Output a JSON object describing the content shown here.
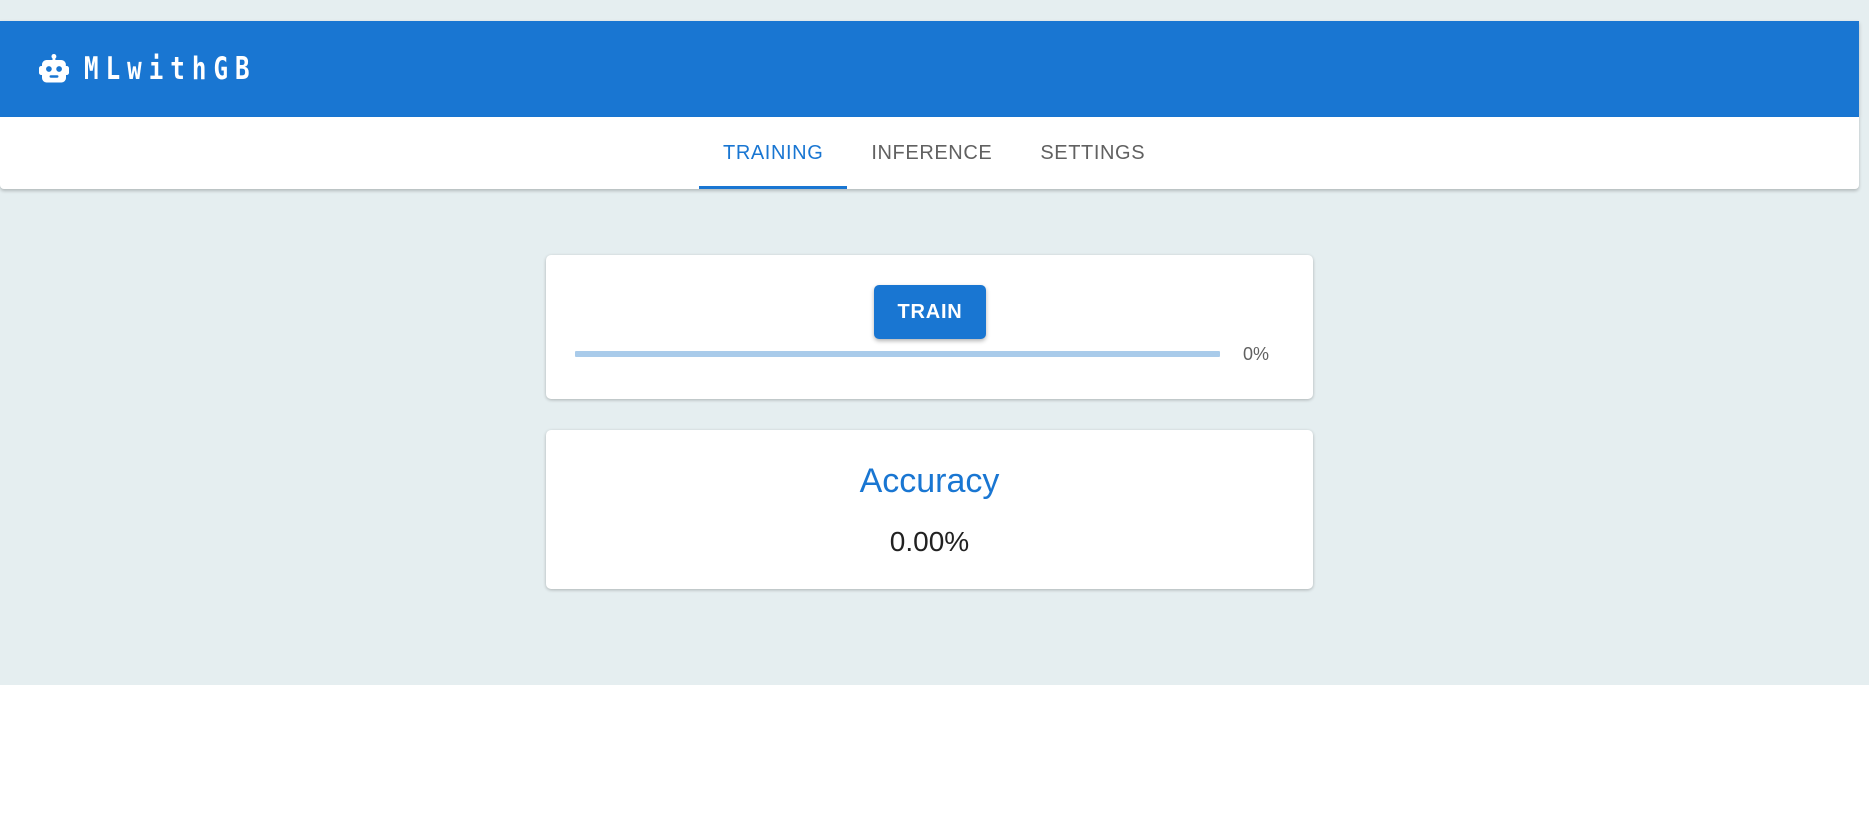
{
  "app": {
    "title": "MLwithGB",
    "logo_icon": "robot-icon",
    "brand_color": "#1976d2"
  },
  "tabs": [
    {
      "label": "TRAINING",
      "active": true
    },
    {
      "label": "INFERENCE",
      "active": false
    },
    {
      "label": "SETTINGS",
      "active": false
    }
  ],
  "training": {
    "button_label": "TRAIN",
    "progress_fraction": 0,
    "progress_label": "0%"
  },
  "accuracy": {
    "title": "Accuracy",
    "value": "0.00%"
  }
}
